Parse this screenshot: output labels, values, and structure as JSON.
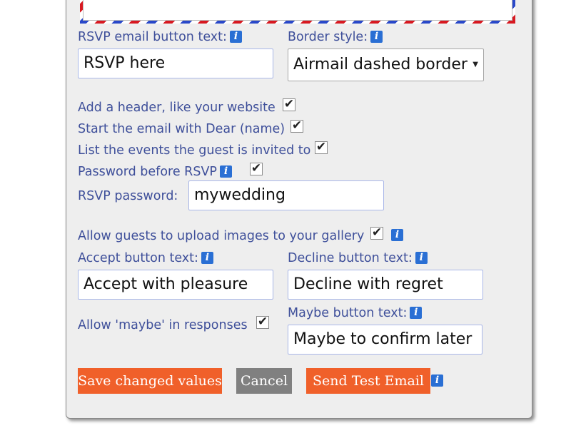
{
  "form": {
    "rsvp_button_label": "RSVP email button text:",
    "rsvp_button_value": "RSVP here",
    "border_style_label": "Border style:",
    "border_style_value": "Airmail dashed border",
    "add_header_label": "Add a header, like your website",
    "start_dear_label": "Start the email with Dear (name)",
    "list_events_label": "List the events the guest is invited to",
    "password_before_label": "Password before RSVP",
    "rsvp_password_label": "RSVP password:",
    "rsvp_password_value": "mywedding",
    "allow_upload_label": "Allow guests to upload images to your gallery",
    "accept_label": "Accept button text:",
    "accept_value": "Accept with pleasure",
    "decline_label": "Decline button text:",
    "decline_value": "Decline with regret",
    "allow_maybe_label": "Allow 'maybe' in responses",
    "maybe_label": "Maybe button text:",
    "maybe_value": "Maybe to confirm later"
  },
  "buttons": {
    "save": "Save changed values",
    "cancel": "Cancel",
    "send_test": "Send Test Email"
  },
  "icons": {
    "info": "i",
    "check": "✔",
    "dropdown": "▼"
  },
  "colors": {
    "label": "#3e4f9a",
    "accent_button": "#f0602a",
    "cancel_button": "#808080",
    "info_icon": "#2a6fd4"
  }
}
